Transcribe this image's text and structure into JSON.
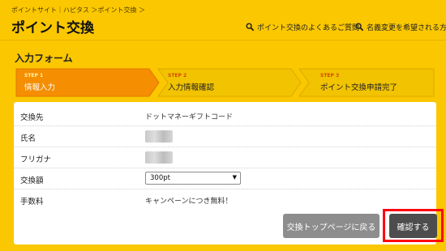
{
  "breadcrumb": "ポイントサイト｜ハピタス ＞ポイント交換 ＞",
  "page_title": "ポイント交換",
  "header_links": [
    {
      "label": "ポイント交換のよくあるご質問",
      "icon": "search-icon"
    },
    {
      "label": "名義変更を希望される方",
      "icon": "search-icon"
    }
  ],
  "form_title": "入力フォーム",
  "steps": [
    {
      "num": "STEP 1",
      "label": "情報入力",
      "state": "active"
    },
    {
      "num": "STEP 2",
      "label": "入力情報確認",
      "state": "inactive"
    },
    {
      "num": "STEP 3",
      "label": "ポイント交換申請完了",
      "state": "inactive"
    }
  ],
  "rows": [
    {
      "label": "交換先",
      "value": "ドットマネーギフトコード"
    },
    {
      "label": "氏名",
      "value": ""
    },
    {
      "label": "フリガナ",
      "value": ""
    },
    {
      "label": "交換額",
      "value": "300pt"
    },
    {
      "label": "手数料",
      "value": "キャンペーンにつき無料！"
    }
  ],
  "buttons": {
    "back": "交換トップページに戻る",
    "confirm": "確認する"
  },
  "colors": {
    "background": "#fbc700",
    "step_active": "#f58e00",
    "step_inactive": "#f2c300",
    "button_back": "#8d8d8d",
    "button_confirm": "#4d4d4d",
    "highlight": "#ff0010"
  }
}
